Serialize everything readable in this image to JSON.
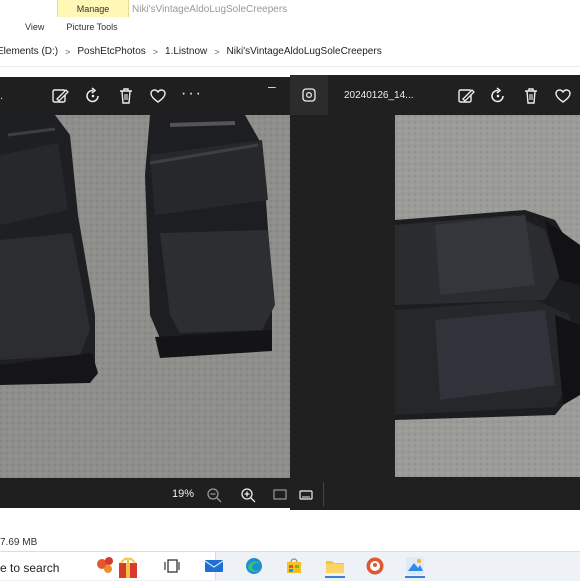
{
  "ribbon": {
    "view_tab": "View",
    "manage_tab": "Manage",
    "picture_tools": "Picture Tools",
    "window_title": "Niki'sVintageAldoLugSoleCreepers"
  },
  "breadcrumb": {
    "items": [
      "Elements (D:)",
      "PoshEtcPhotos",
      "1.Listnow",
      "Niki'sVintageAldoLugSoleCreepers"
    ]
  },
  "viewer_left": {
    "title_fragment": ".",
    "zoom": "19%"
  },
  "viewer_right": {
    "title": "20240126_14..."
  },
  "status": {
    "size": "7.69 MB"
  },
  "taskbar": {
    "search_text": "e to search"
  },
  "colors": {
    "manage_tab": "#fff7b6",
    "viewer_bg": "#1f1f1f",
    "taskbar_bg": "#eef1f6"
  }
}
